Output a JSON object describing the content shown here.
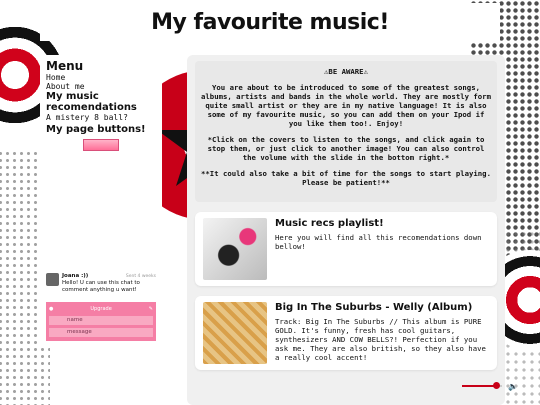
{
  "header": {
    "title": "My favourite music!"
  },
  "sidebar": {
    "menu_title": "Menu",
    "items": [
      {
        "label": "Home"
      },
      {
        "label": "About me"
      },
      {
        "label": "My music recomendations"
      },
      {
        "label": "A mistery 8 ball?"
      }
    ],
    "buttons_title": "My page buttons!"
  },
  "chat": {
    "user": "Joana :))",
    "time": "Sent 4 weeks",
    "message": "Hello! U can use this chat to comment anything u want!",
    "upgrade_label": "Upgrade",
    "name_placeholder": "name",
    "message_placeholder": "message"
  },
  "warning": {
    "title": "⚠BE AWARE⚠",
    "paragraphs": [
      "You are about to be introduced to some of the greatest songs, albums, artists and bands in the whole world. They are mostly form quite small artist or they are in my native language! It is also some of my favourite music, so you can add them on your Ipod if you like them too!. Enjoy!",
      "*Click on the covers to listen to the songs, and click again to stop them, or just click to another image! You can also control the volume with the slide in the bottom right.*",
      "**It could also take a bit of time for the songs to start playing. Please be patient!**"
    ]
  },
  "cards": [
    {
      "title": "Music recs playlist!",
      "text": "Here you will find all this recomendations down bellow!"
    },
    {
      "title": "Big In The Suburbs - Welly (Album)",
      "text": "Track: Big In The Suburbs // This album is PURE GOLD. It's funny, fresh has cool guitars, synthesizers AND COW BELLS?! Perfection if you ask me. They are also british, so they also have a really cool accent!"
    }
  ],
  "volume": {
    "level": 0.85,
    "icon": "speaker-icon"
  },
  "colors": {
    "accent": "#c80018",
    "chat_pink": "#f57ea5"
  }
}
